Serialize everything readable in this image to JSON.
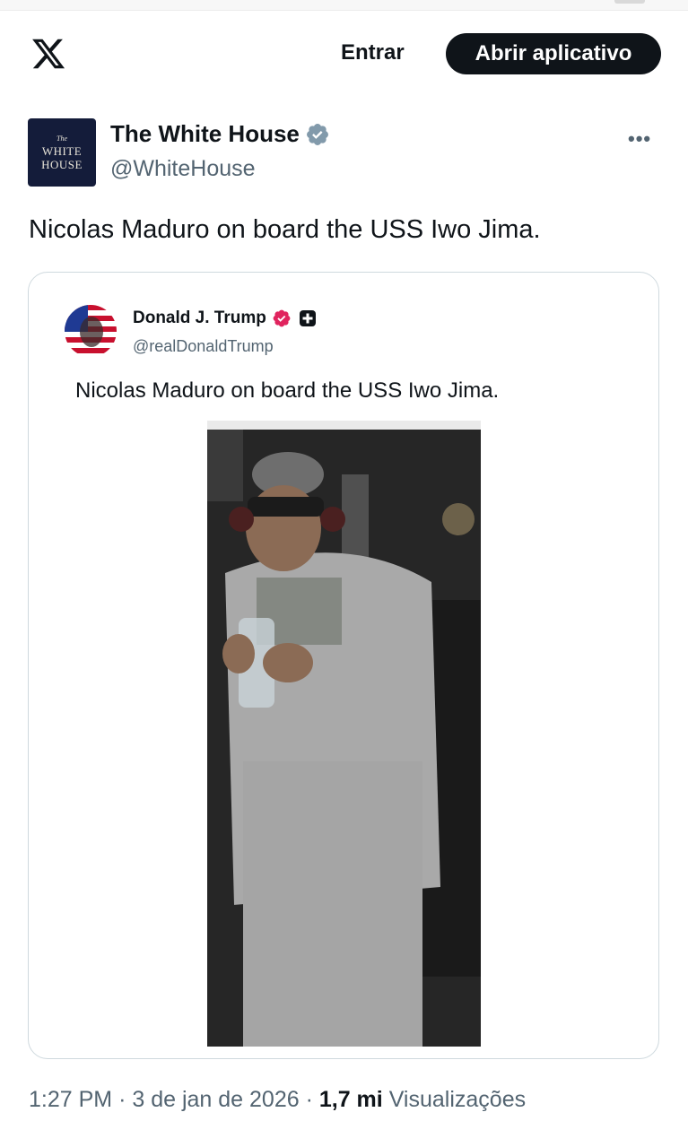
{
  "header": {
    "logo_icon": "x-logo-icon",
    "login_label": "Entrar",
    "open_app_label": "Abrir aplicativo"
  },
  "author": {
    "avatar_text": [
      "The",
      "WHITE",
      "HOUSE"
    ],
    "name": "The White House",
    "handle": "@WhiteHouse",
    "verified_icon": "verified-gray-badge-icon",
    "more_icon": "more-options-icon",
    "more_glyph": "•••"
  },
  "tweet": {
    "text": "Nicolas Maduro on board the USS Iwo Jima."
  },
  "quoted": {
    "name": "Donald J. Trump",
    "handle": "@realDonaldTrump",
    "text": "Nicolas Maduro on board the USS Iwo Jima.",
    "verified_icon": "verified-pink-badge-icon",
    "affiliation_icon": "affiliation-badge-icon"
  },
  "meta": {
    "time": "1:27 PM",
    "separator": "·",
    "date": "3 de jan de 2026",
    "views_count": "1,7 mi",
    "views_label": "Visualizações"
  },
  "colors": {
    "primary_text": "#0f1419",
    "secondary_text": "#536471",
    "border": "#cfd9de",
    "button_bg": "#0f1419",
    "verified_gray": "#829aab",
    "verified_pink": "#e0245e"
  }
}
